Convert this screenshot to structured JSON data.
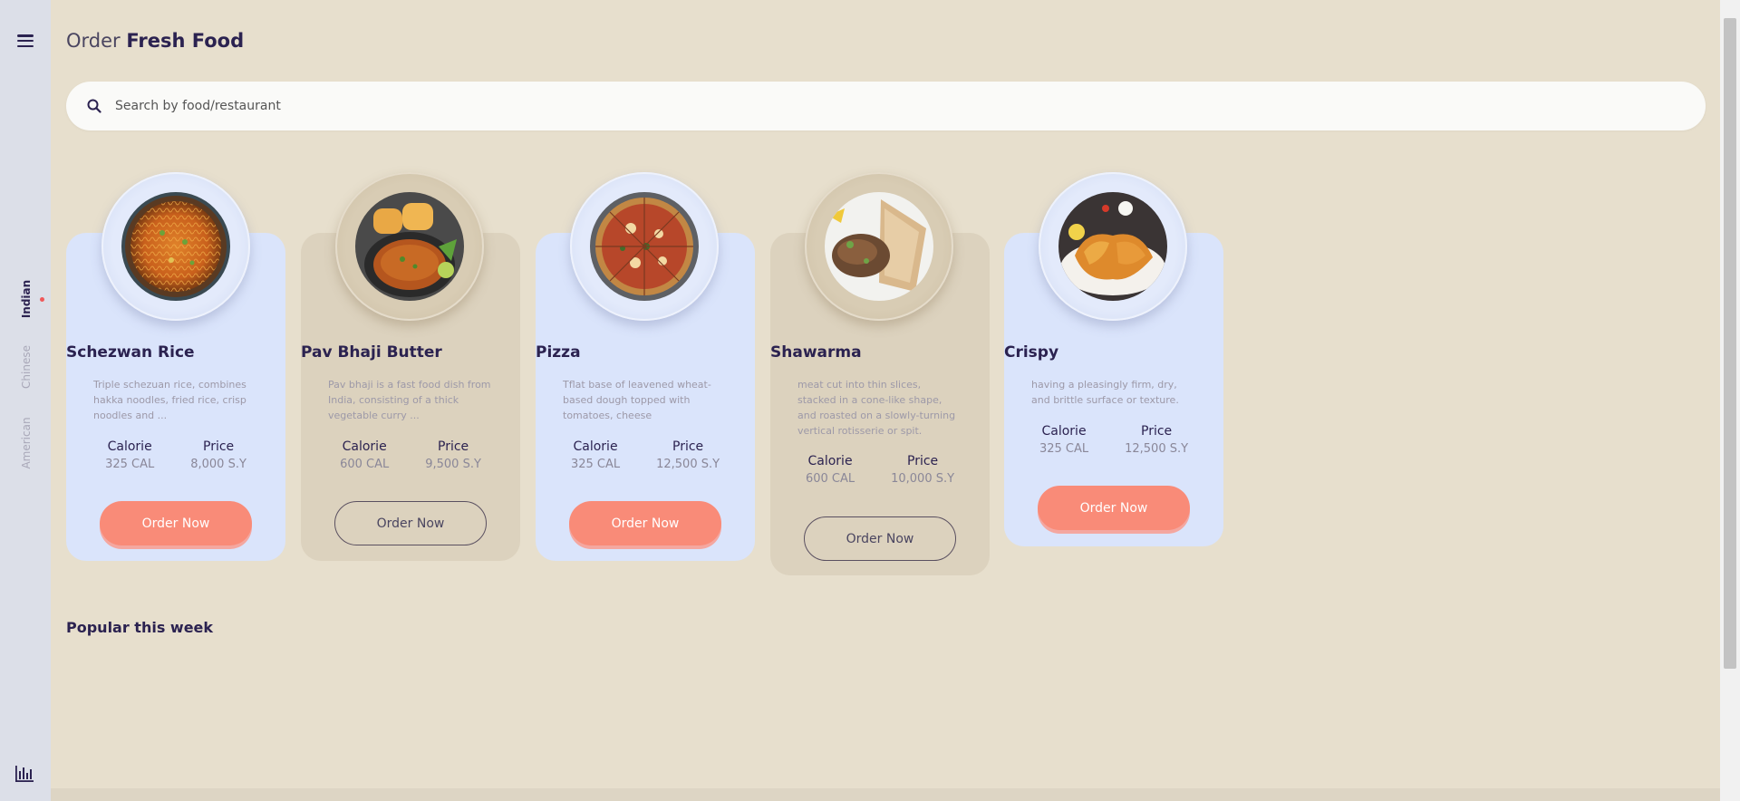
{
  "sidebar": {
    "categories": [
      "Indian",
      "Chinese",
      "American"
    ]
  },
  "header": {
    "title_light": "Order",
    "title_bold": "Fresh Food"
  },
  "search": {
    "placeholder": "Search by food/restaurant"
  },
  "cards": [
    {
      "name": "Schezwan Rice",
      "description": "Triple schezuan rice, combines hakka noodles, fried rice, crisp noodles and ...",
      "calorie_label": "Calorie",
      "calorie": "325 CAL",
      "price_label": "Price",
      "price": "8,000 S.Y",
      "button": "Order Now",
      "style": "blue"
    },
    {
      "name": "Pav Bhaji Butter",
      "description": "Pav bhaji is a fast food dish from India, consisting of a thick vegetable curry ...",
      "calorie_label": "Calorie",
      "calorie": "600 CAL",
      "price_label": "Price",
      "price": "9,500 S.Y",
      "button": "Order Now",
      "style": "tan"
    },
    {
      "name": "Pizza",
      "description": "Tflat base of leavened wheat-based dough topped with tomatoes, cheese",
      "calorie_label": "Calorie",
      "calorie": "325 CAL",
      "price_label": "Price",
      "price": "12,500 S.Y",
      "button": "Order Now",
      "style": "blue"
    },
    {
      "name": "Shawarma",
      "description": "meat cut into thin slices, stacked in a cone-like shape, and roasted on a slowly-turning vertical rotisserie or spit.",
      "calorie_label": "Calorie",
      "calorie": "600 CAL",
      "price_label": "Price",
      "price": "10,000 S.Y",
      "button": "Order Now",
      "style": "tan"
    },
    {
      "name": "Crispy",
      "description": "having a pleasingly firm, dry, and brittle surface or texture.",
      "calorie_label": "Calorie",
      "calorie": "325 CAL",
      "price_label": "Price",
      "price": "12,500 S.Y",
      "button": "Order Now",
      "style": "blue"
    }
  ],
  "popular": {
    "heading": "Popular this week"
  },
  "colors": {
    "background": "#e7dfcd",
    "sidebar": "#dcdfe8",
    "card_blue": "#dae4fb",
    "card_tan": "#dcd2be",
    "accent": "#f98b78",
    "text_dark": "#2b2250"
  },
  "icons": [
    "menu-icon",
    "search-icon",
    "chart-bar-icon"
  ]
}
